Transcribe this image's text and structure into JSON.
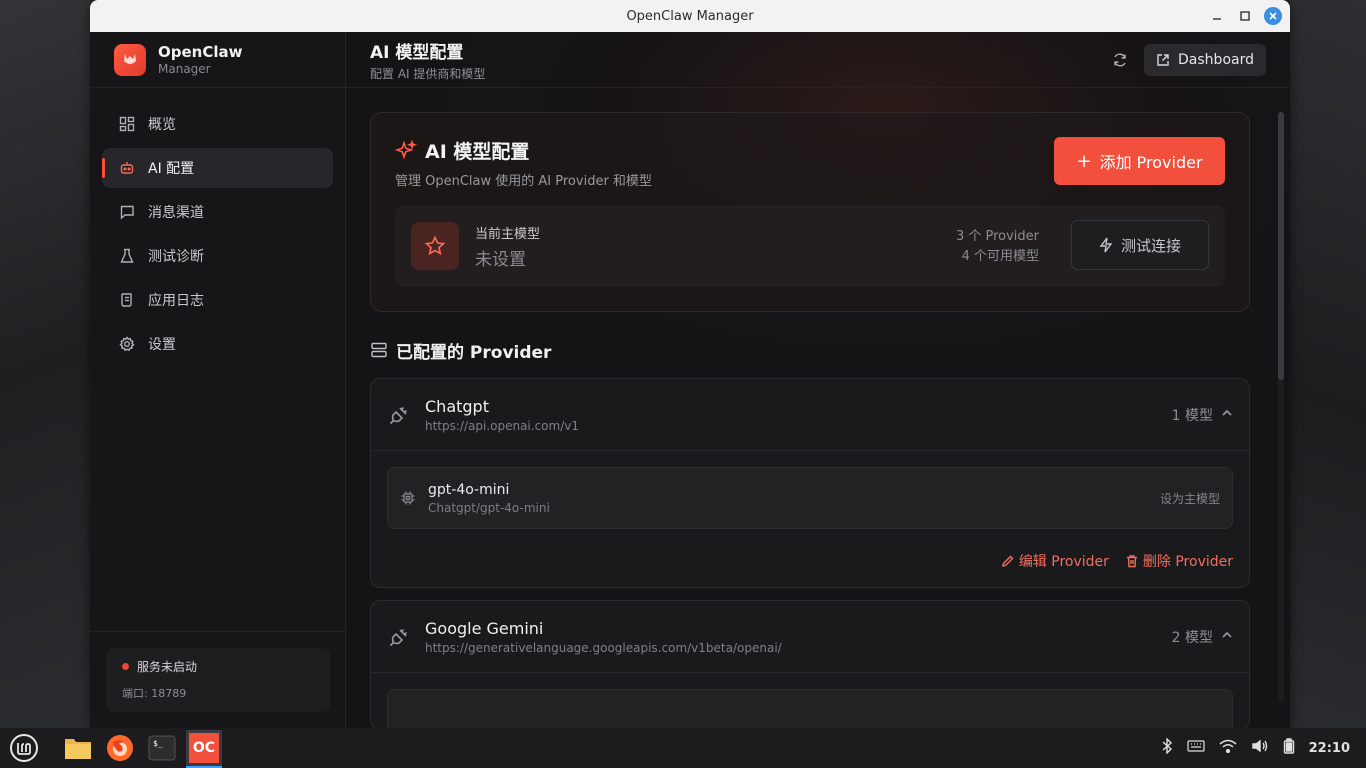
{
  "window": {
    "title": "OpenClaw Manager"
  },
  "brand": {
    "name": "OpenClaw",
    "sub": "Manager"
  },
  "sidebar": {
    "items": [
      {
        "label": "概览",
        "icon": "grid-icon",
        "active": false
      },
      {
        "label": "AI 配置",
        "icon": "bot-icon",
        "active": true
      },
      {
        "label": "消息渠道",
        "icon": "message-icon",
        "active": false
      },
      {
        "label": "测试诊断",
        "icon": "flask-icon",
        "active": false
      },
      {
        "label": "应用日志",
        "icon": "scroll-icon",
        "active": false
      },
      {
        "label": "设置",
        "icon": "gear-icon",
        "active": false
      }
    ],
    "status": "服务未启动",
    "port": "端口: 18789"
  },
  "header": {
    "title": "AI 模型配置",
    "subtitle": "配置 AI 提供商和模型",
    "dashboard_label": "Dashboard"
  },
  "config_card": {
    "title": "AI 模型配置",
    "description": "管理 OpenClaw 使用的 AI Provider 和模型",
    "add_label": "添加 Provider",
    "primary_label": "当前主模型",
    "primary_value": "未设置",
    "provider_count": "3 个 Provider",
    "model_count": "4 个可用模型",
    "test_label": "测试连接"
  },
  "providers_section": {
    "title": "已配置的 Provider"
  },
  "providers": [
    {
      "name": "Chatgpt",
      "url": "https://api.openai.com/v1",
      "model_count": "1 模型",
      "models": [
        {
          "name": "gpt-4o-mini",
          "path": "Chatgpt/gpt-4o-mini",
          "action": "设为主模型"
        }
      ],
      "edit_label": "编辑 Provider",
      "delete_label": "删除 Provider"
    },
    {
      "name": "Google Gemini",
      "url": "https://generativelanguage.googleapis.com/v1beta/openai/",
      "model_count": "2 模型"
    }
  ],
  "taskbar": {
    "active_app_label": "OC",
    "time": "22:10"
  },
  "colors": {
    "accent": "#f2503d",
    "status_red": "#f0433a",
    "taskbar_active": "#3fa0ff"
  }
}
